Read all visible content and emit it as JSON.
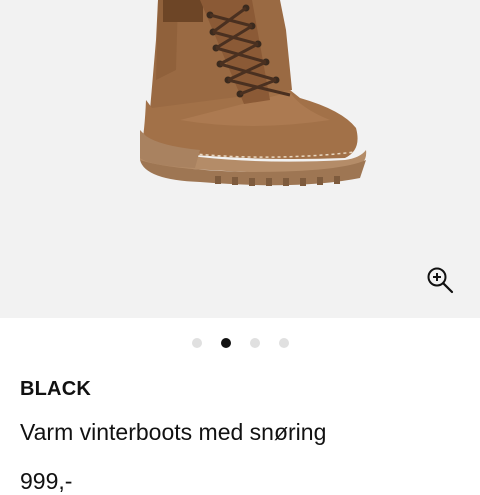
{
  "product": {
    "brand": "BLACK",
    "name": "Varm vinterboots med snøring",
    "price": "999,-"
  },
  "gallery": {
    "image_subject": "brown lace-up winter boot",
    "zoom_icon": "zoom-in-icon",
    "slide_count": 4,
    "active_slide": 2
  },
  "colors": {
    "gallery_background": "#f2f2f2",
    "boot_leather": "#9c6b43",
    "sole": "#b08a67",
    "active_dot": "#111111",
    "inactive_dot": "#e0e0e0"
  }
}
